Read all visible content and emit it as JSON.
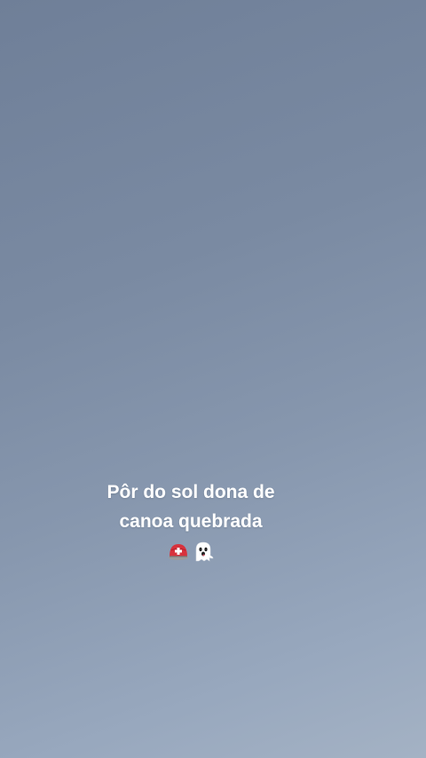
{
  "caption": {
    "line1": "Pôr do sol dona de",
    "line2": "canoa quebrada",
    "emojis": [
      "rescue-worker-helmet-icon",
      "ghost-icon"
    ]
  },
  "colors": {
    "sky_top": "#6f7f98",
    "sky_bottom": "#a4b2c4",
    "text": "#ffffff"
  }
}
